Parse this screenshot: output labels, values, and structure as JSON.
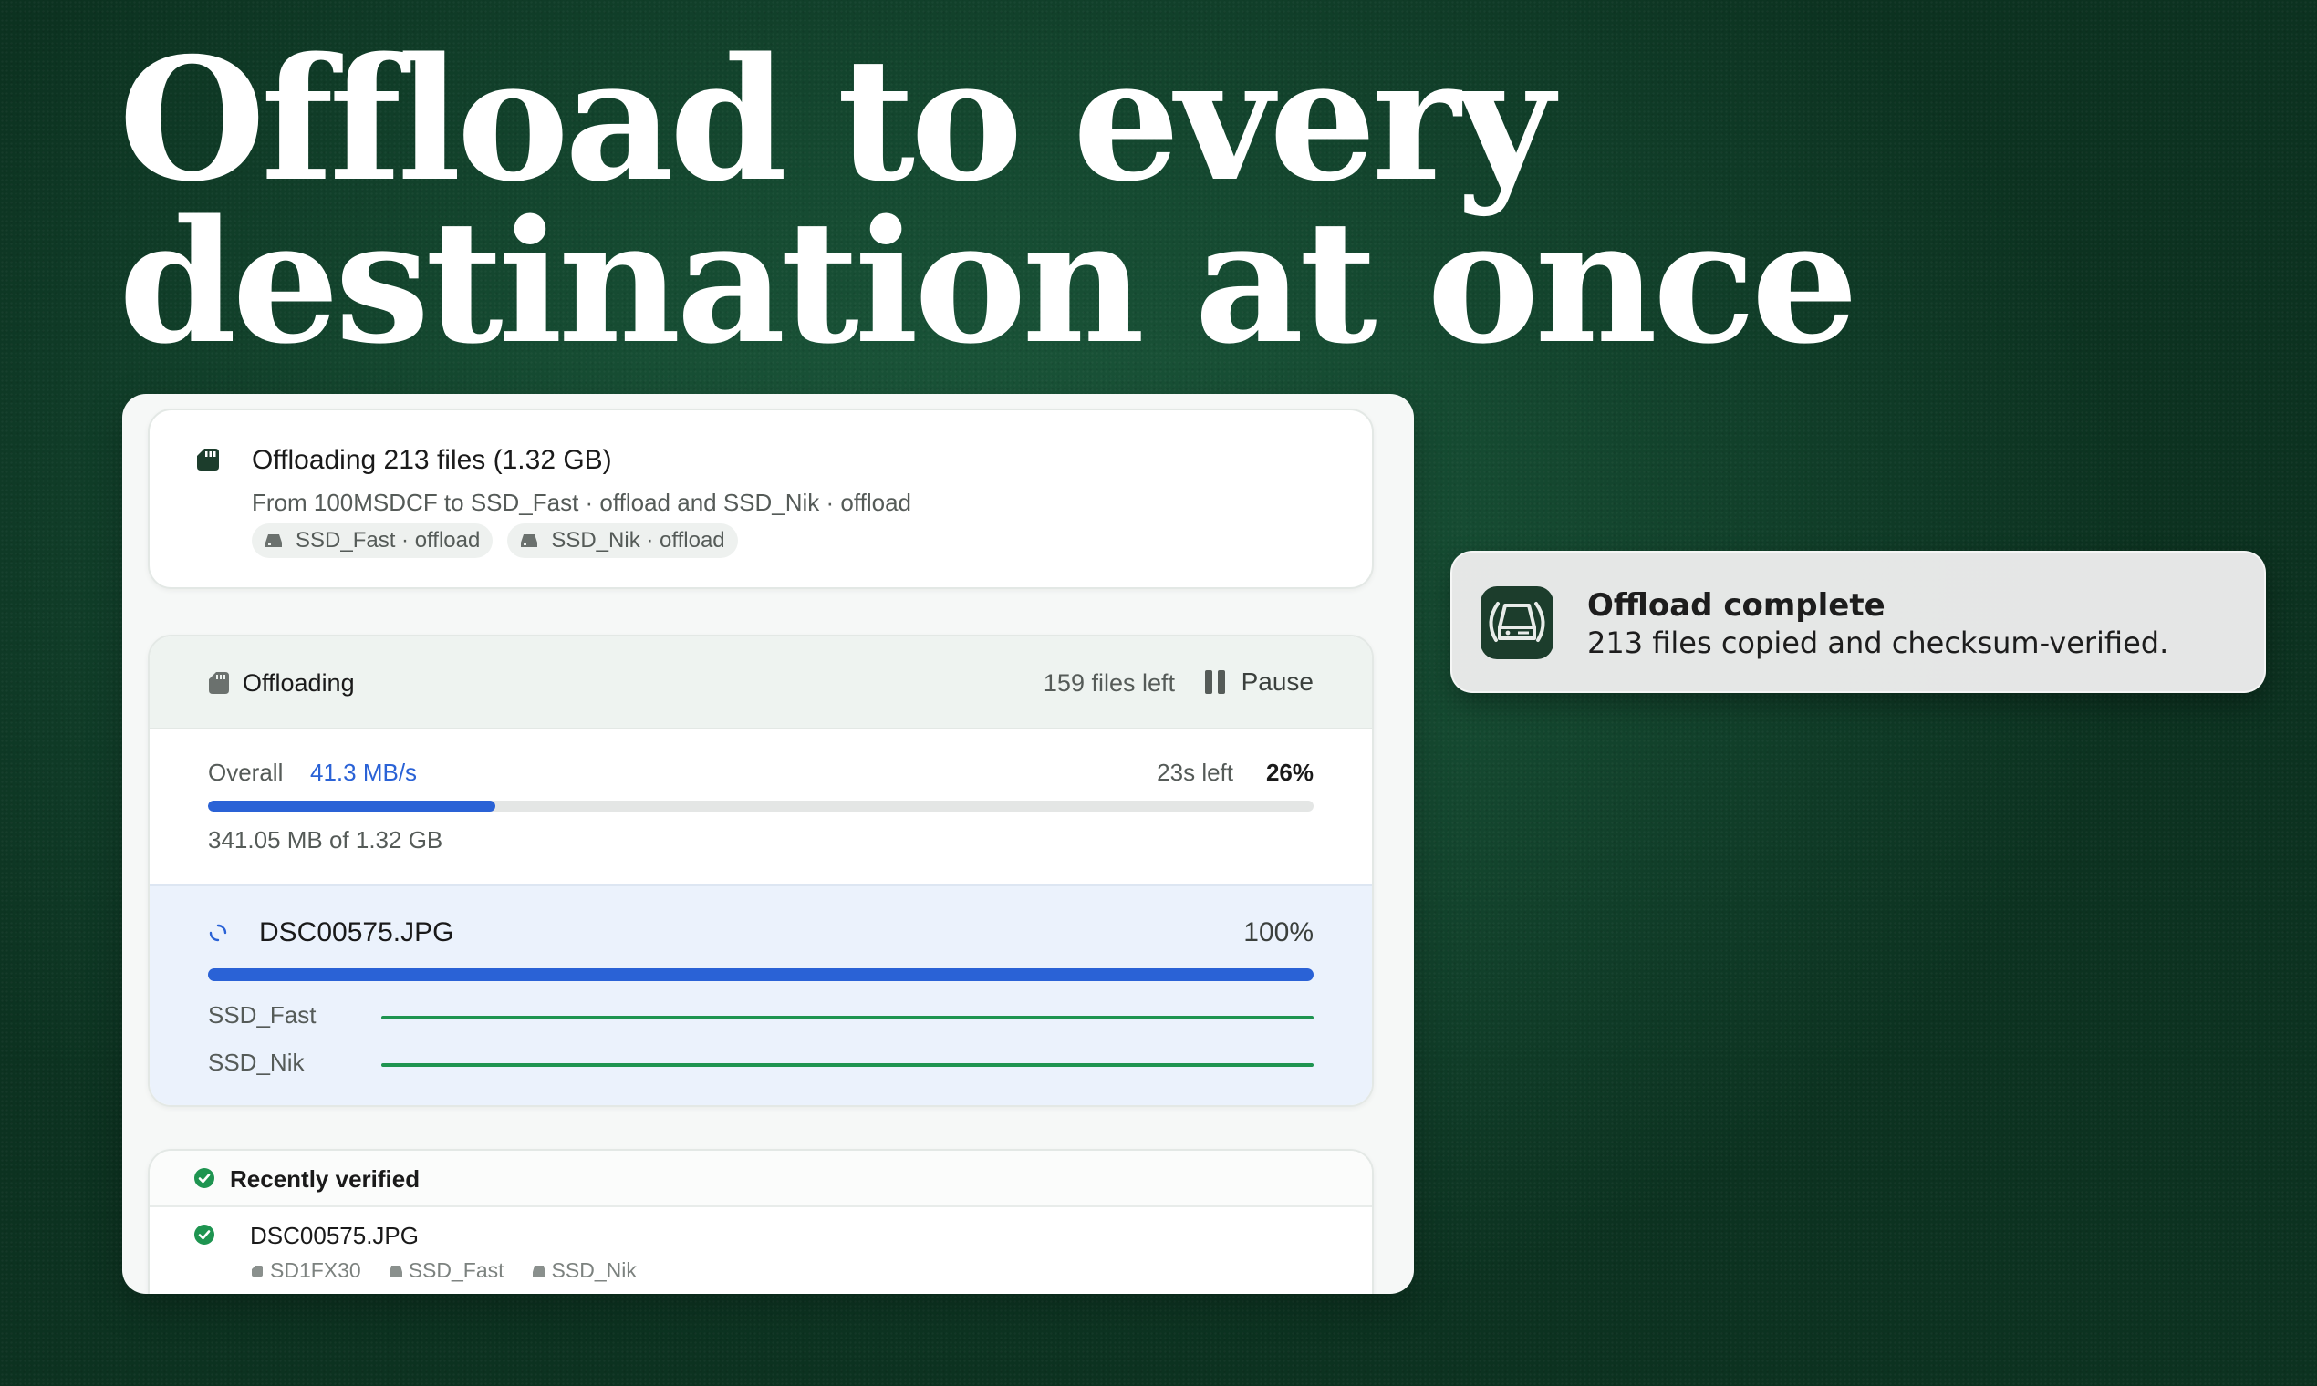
{
  "headline": {
    "line1": "Offload to every",
    "line2": "destination at once"
  },
  "summary": {
    "title": "Offloading 213 files (1.32 GB)",
    "subtitle": "From 100MSDCF to SSD_Fast · offload and SSD_Nik · offload",
    "chips": [
      {
        "label": "SSD_Fast · offload",
        "icon": "drive-icon"
      },
      {
        "label": "SSD_Nik · offload",
        "icon": "drive-icon"
      }
    ]
  },
  "progress": {
    "header_label": "Offloading",
    "files_left": "159 files left",
    "pause_label": "Pause",
    "overall_label": "Overall",
    "speed": "41.3 MB/s",
    "eta": "23s left",
    "percent_label": "26%",
    "percent_value": 26,
    "bytes_progress": "341.05 MB of 1.32 GB",
    "current_file": {
      "name": "DSC00575.JPG",
      "percent_label": "100%",
      "percent_value": 100,
      "destinations": [
        {
          "name": "SSD_Fast",
          "percent_value": 100
        },
        {
          "name": "SSD_Nik",
          "percent_value": 100
        }
      ]
    }
  },
  "verified": {
    "title": "Recently verified",
    "items": [
      {
        "name": "DSC00575.JPG",
        "locations": [
          "SD1FX30",
          "SSD_Fast",
          "SSD_Nik"
        ]
      }
    ]
  },
  "notification": {
    "title": "Offload complete",
    "body": "213 files copied and checksum-verified."
  },
  "colors": {
    "accent_blue": "#2a62d6",
    "success_green": "#1e9450",
    "background_green": "#154a31"
  }
}
